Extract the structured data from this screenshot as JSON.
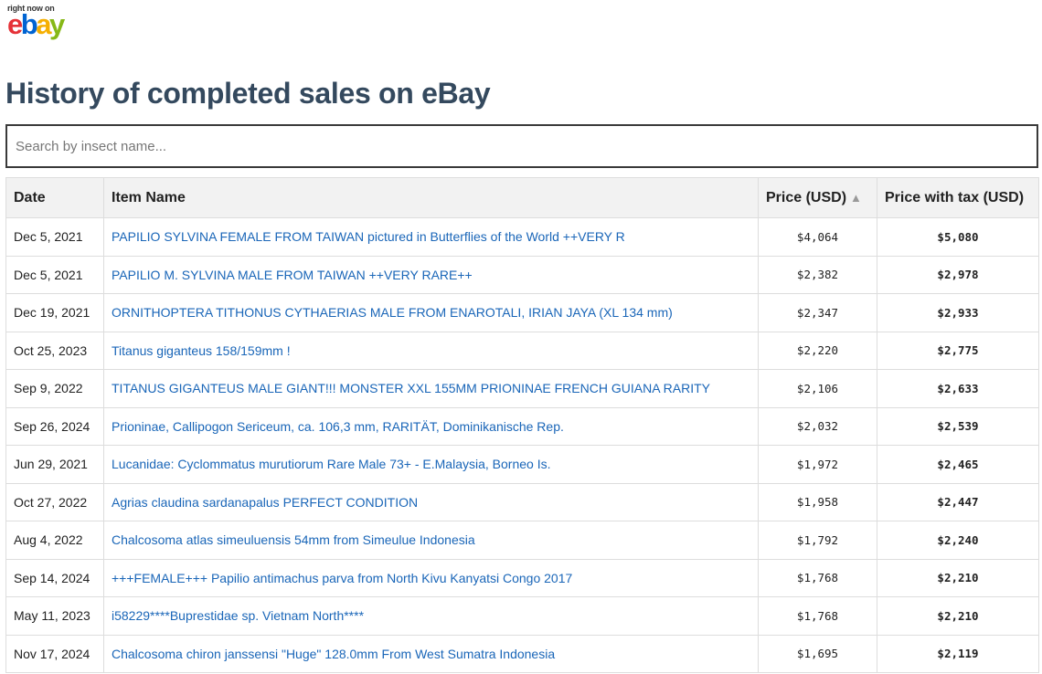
{
  "logo": {
    "tagline": "right now on",
    "letters": [
      "e",
      "b",
      "a",
      "y"
    ]
  },
  "page_title": "History of completed sales on eBay",
  "search": {
    "placeholder": "Search by insect name...",
    "value": ""
  },
  "table": {
    "headers": {
      "date": "Date",
      "item": "Item Name",
      "price": "Price (USD)",
      "price_sort": "▲",
      "price_tax": "Price with tax (USD)"
    },
    "rows": [
      {
        "date": "Dec 5, 2021",
        "item": "PAPILIO SYLVINA FEMALE FROM TAIWAN pictured in Butterflies of the World ++VERY R",
        "price": "$4,064",
        "price_tax": "$5,080"
      },
      {
        "date": "Dec 5, 2021",
        "item": "PAPILIO M. SYLVINA MALE FROM TAIWAN ++VERY RARE++",
        "price": "$2,382",
        "price_tax": "$2,978"
      },
      {
        "date": "Dec 19, 2021",
        "item": "ORNITHOPTERA TITHONUS CYTHAERIAS MALE FROM ENAROTALI, IRIAN JAYA (XL 134 mm)",
        "price": "$2,347",
        "price_tax": "$2,933"
      },
      {
        "date": "Oct 25, 2023",
        "item": "Titanus giganteus 158/159mm !",
        "price": "$2,220",
        "price_tax": "$2,775"
      },
      {
        "date": "Sep 9, 2022",
        "item": "TITANUS GIGANTEUS MALE GIANT!!! MONSTER XXL 155MM PRIONINAE FRENCH GUIANA RARITY",
        "price": "$2,106",
        "price_tax": "$2,633"
      },
      {
        "date": "Sep 26, 2024",
        "item": "Prioninae, Callipogon Sericeum, ca. 106,3 mm, RARITÄT, Dominikanische Rep.",
        "price": "$2,032",
        "price_tax": "$2,539"
      },
      {
        "date": "Jun 29, 2021",
        "item": "Lucanidae: Cyclommatus murutiorum Rare Male 73+ - E.Malaysia, Borneo Is.",
        "price": "$1,972",
        "price_tax": "$2,465"
      },
      {
        "date": "Oct 27, 2022",
        "item": "Agrias claudina sardanapalus PERFECT CONDITION",
        "price": "$1,958",
        "price_tax": "$2,447"
      },
      {
        "date": "Aug 4, 2022",
        "item": "Chalcosoma atlas simeuluensis 54mm from Simeulue Indonesia",
        "price": "$1,792",
        "price_tax": "$2,240"
      },
      {
        "date": "Sep 14, 2024",
        "item": "+++FEMALE+++ Papilio antimachus parva from North Kivu Kanyatsi Congo 2017",
        "price": "$1,768",
        "price_tax": "$2,210"
      },
      {
        "date": "May 11, 2023",
        "item": "i58229****Buprestidae sp. Vietnam North****",
        "price": "$1,768",
        "price_tax": "$2,210"
      },
      {
        "date": "Nov 17, 2024",
        "item": "Chalcosoma chiron janssensi \"Huge\" 128.0mm From West Sumatra Indonesia",
        "price": "$1,695",
        "price_tax": "$2,119"
      }
    ]
  }
}
